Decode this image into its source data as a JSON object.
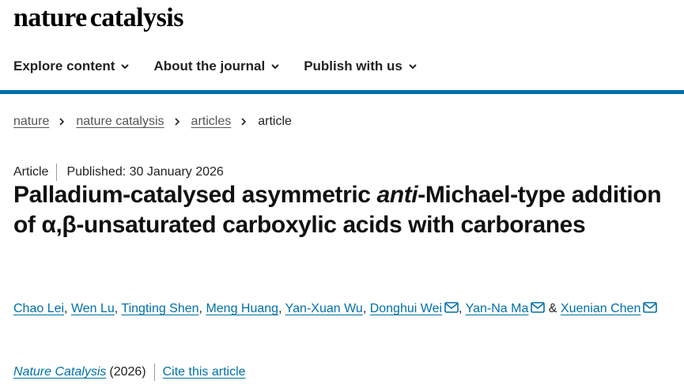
{
  "site": {
    "logo_word1": "nature",
    "logo_word2": "catalysis"
  },
  "nav": {
    "items": [
      {
        "label": "Explore content",
        "icon": "chevron-down-icon"
      },
      {
        "label": "About the journal",
        "icon": "chevron-down-icon"
      },
      {
        "label": "Publish with us",
        "icon": "chevron-down-icon"
      }
    ]
  },
  "breadcrumb": {
    "items": [
      "nature",
      "nature catalysis",
      "articles"
    ],
    "current": "article",
    "separator_icon": "chevron-right-icon"
  },
  "article": {
    "type": "Article",
    "published": "Published: 30 January 2026",
    "title_part1": "Palladium-catalysed asymmetric ",
    "title_italic": "anti",
    "title_part2": "-Michael-type addition of α,β-unsaturated carboxylic acids with carboranes",
    "authors": [
      {
        "name": "Chao Lei",
        "email": false
      },
      {
        "name": "Wen Lu",
        "email": false
      },
      {
        "name": "Tingting Shen",
        "email": false
      },
      {
        "name": "Meng Huang",
        "email": false
      },
      {
        "name": "Yan-Xuan Wu",
        "email": false
      },
      {
        "name": "Donghui Wei",
        "email": true
      },
      {
        "name": "Yan-Na Ma",
        "email": true
      },
      {
        "name": "Xuenian Chen",
        "email": true
      }
    ],
    "author_separator": ", ",
    "author_final_separator": " & ",
    "journal": "Nature Catalysis",
    "year": "(2026)",
    "cite_label": "Cite this article"
  },
  "colors": {
    "accent": "#0070a8",
    "text": "#222222",
    "muted": "#555555"
  }
}
